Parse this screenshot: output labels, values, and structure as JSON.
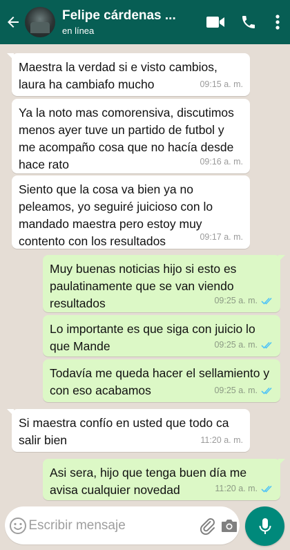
{
  "header": {
    "contact_name": "Felipe cárdenas ...",
    "status": "en línea",
    "icons": [
      "back-arrow-icon",
      "video-call-icon",
      "phone-call-icon",
      "more-options-icon"
    ]
  },
  "messages": [
    {
      "direction": "in",
      "text": "Maestra la verdad si e visto cambios, laura ha cambiafo mucho",
      "time": "09:15 a. m."
    },
    {
      "direction": "in",
      "text": "Ya la noto mas comorensiva, discutimos menos ayer tuve un partido de futbol y me acompaño cosa que no hacía desde hace rato",
      "time": "09:16 a. m."
    },
    {
      "direction": "in",
      "text": "Siento que la cosa va bien ya no peleamos, yo seguiré juicioso con lo mandado maestra pero estoy muy contento con los resultados",
      "time": "09:17 a. m."
    },
    {
      "direction": "out",
      "text": "Muy buenas noticias hijo si esto es paulatinamente que se van viendo resultados",
      "time": "09:25 a. m.",
      "status": "read"
    },
    {
      "direction": "out",
      "text": "Lo importante es que siga con juicio lo que Mande",
      "time": "09:25 a. m.",
      "status": "read"
    },
    {
      "direction": "out",
      "text": "Todavía me queda hacer el sellamiento y con eso acabamos",
      "time": "09:25 a. m.",
      "status": "read"
    },
    {
      "direction": "in",
      "text": "Si maestra  confío en usted que todo ca salir bien",
      "time": "11:20 a. m."
    },
    {
      "direction": "out",
      "text": "Asi sera, hijo que tenga buen día me avisa cualquier novedad",
      "time": "11:20 a. m.",
      "status": "read"
    }
  ],
  "composer": {
    "placeholder": "Escribir mensaje",
    "value": ""
  },
  "colors": {
    "header_bg": "#075e54",
    "chat_bg": "#e5ddd5",
    "outgoing_bubble": "#dcf8c6",
    "incoming_bubble": "#ffffff",
    "read_ticks": "#4fc3f7",
    "mic_button": "#00897b"
  }
}
